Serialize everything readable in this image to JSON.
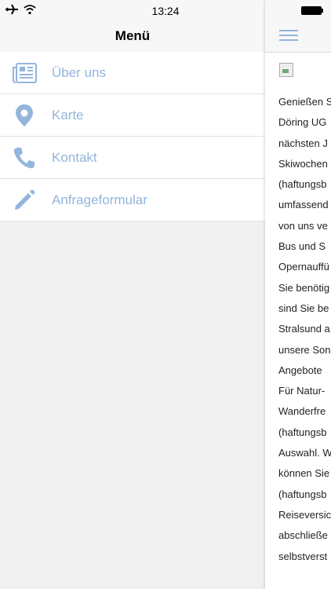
{
  "statusbar": {
    "time": "13:24",
    "airplane_icon": "airplane-icon",
    "wifi_icon": "wifi-icon",
    "battery_icon": "battery-icon"
  },
  "drawer": {
    "title": "Menü",
    "items": [
      {
        "label": "Über uns",
        "icon": "newspaper-icon"
      },
      {
        "label": "Karte",
        "icon": "location-pin-icon"
      },
      {
        "label": "Kontakt",
        "icon": "phone-icon"
      },
      {
        "label": "Anfrageformular",
        "icon": "pencil-icon"
      }
    ]
  },
  "content": {
    "menu_icon": "hamburger-icon",
    "lines": [
      "Genießen S",
      "Döring UG",
      "nächsten J",
      "Skiwochen",
      "(haftungsb",
      "umfassend",
      "von uns ve",
      "Bus und S",
      "Opernauffü",
      "Sie benötig",
      "sind Sie be",
      "Stralsund a",
      "unsere Son",
      "Angebote",
      "Für Natur-",
      "Wanderfre",
      "(haftungsb",
      "Auswahl. W",
      "können Sie",
      "(haftungsb",
      "Reiseversic",
      "abschließe",
      "selbstverst"
    ]
  },
  "colors": {
    "accent": "#93b5db",
    "background": "#f0f0f0"
  }
}
